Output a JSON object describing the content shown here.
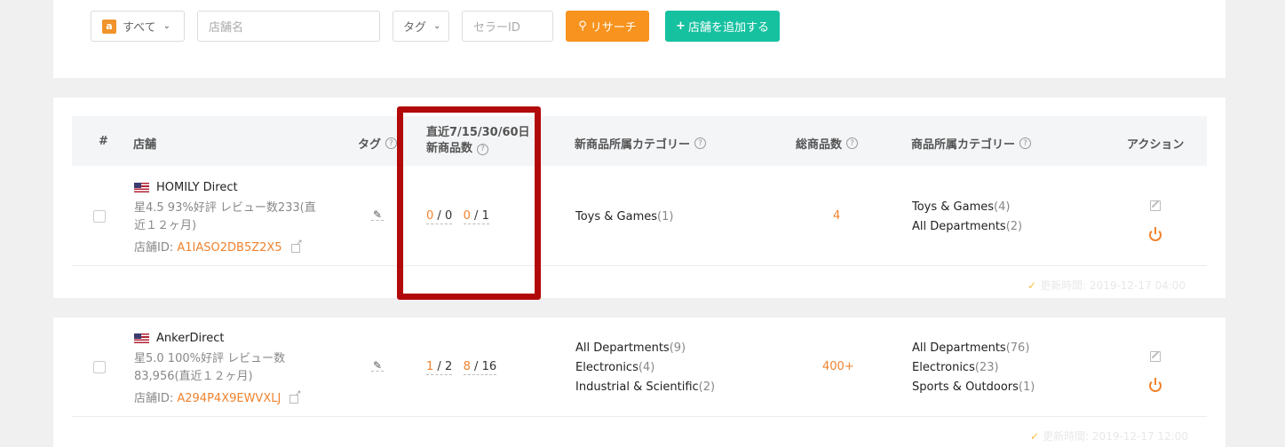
{
  "filters": {
    "marketplace": "すべて",
    "store_name_placeholder": "店舗名",
    "tag_label": "タグ",
    "seller_id_placeholder": "セラーID",
    "search_button": "リサーチ",
    "add_store_button": "店舗を追加する"
  },
  "table": {
    "headers": {
      "index": "#",
      "store": "店舗",
      "tag": "タグ",
      "new_products_line1": "直近7/15/30/60日",
      "new_products_line2": "新商品数",
      "new_categories": "新商品所属カテゴリー",
      "total_products": "総商品数",
      "product_categories": "商品所属カテゴリー",
      "actions": "アクション"
    }
  },
  "rows": [
    {
      "name": "HOMILY Direct",
      "meta_line1": "星4.5  93%好評  レビュー数233(直",
      "meta_line2": "近１２ヶ月)",
      "id_label": "店舗ID:",
      "id_value": "A1IASO2DB5Z2X5",
      "count7": "0",
      "count15": "0",
      "count30": "0",
      "count60": "1",
      "new_cats": [
        {
          "name": "Toys & Games",
          "count": "(1)"
        }
      ],
      "total": "4",
      "cats": [
        {
          "name": "Toys & Games",
          "count": "(4)"
        },
        {
          "name": "All Departments",
          "count": "(2)"
        }
      ],
      "updated": "更新時間: 2019-12-17 04:00"
    },
    {
      "name": "AnkerDirect",
      "meta_line1": "星5.0  100%好評  レビュー数",
      "meta_line2": "83,956(直近１２ヶ月)",
      "id_label": "店舗ID:",
      "id_value": "A294P4X9EWVXLJ",
      "count7": "1",
      "count15": "2",
      "count30": "8",
      "count60": "16",
      "new_cats": [
        {
          "name": "All Departments",
          "count": "(9)"
        },
        {
          "name": "Electronics",
          "count": "(4)"
        },
        {
          "name": "Industrial & Scientific",
          "count": "(2)"
        }
      ],
      "total": "400+",
      "cats": [
        {
          "name": "All Departments",
          "count": "(76)"
        },
        {
          "name": "Electronics",
          "count": "(23)"
        },
        {
          "name": "Sports & Outdoors",
          "count": "(1)"
        }
      ],
      "updated": "更新時間: 2019-12-17 12:00"
    }
  ]
}
